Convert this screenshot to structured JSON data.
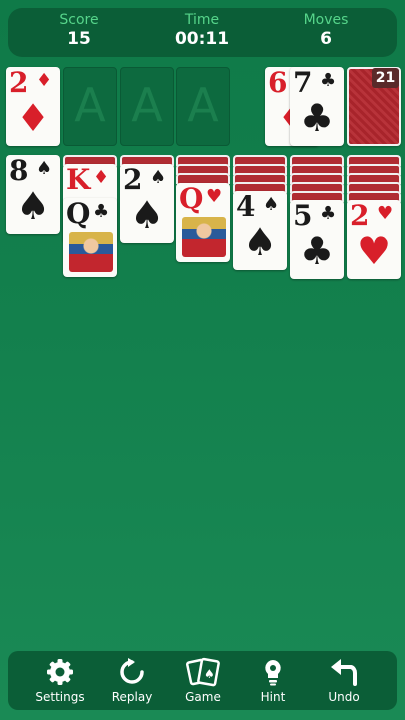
{
  "header": {
    "score_label": "Score",
    "score_value": "15",
    "time_label": "Time",
    "time_value": "00:11",
    "moves_label": "Moves",
    "moves_value": "6"
  },
  "foundations": [
    {
      "rank": "2",
      "suit": "♦",
      "color": "red"
    },
    {
      "placeholder": "A"
    },
    {
      "placeholder": "A"
    },
    {
      "placeholder": "A"
    }
  ],
  "waste": [
    {
      "rank": "6",
      "suit": "♦",
      "color": "red"
    },
    {
      "rank": "7",
      "suit": "♣",
      "color": "black"
    }
  ],
  "stock": {
    "count": "21"
  },
  "tableau": [
    {
      "top": {
        "rank": "8",
        "suit": "♠",
        "color": "black"
      }
    },
    {
      "peek": {
        "rank": "K",
        "suit": "♦",
        "color": "red"
      },
      "top": {
        "rank": "Q",
        "suit": "♣",
        "color": "black"
      }
    },
    {
      "top": {
        "rank": "2",
        "suit": "♠",
        "color": "black"
      }
    },
    {
      "top": {
        "rank": "Q",
        "suit": "♥",
        "color": "red"
      }
    },
    {
      "top": {
        "rank": "4",
        "suit": "♠",
        "color": "black"
      }
    },
    {
      "top": {
        "rank": "5",
        "suit": "♣",
        "color": "black"
      }
    },
    {
      "top": {
        "rank": "2",
        "suit": "♥",
        "color": "red"
      }
    }
  ],
  "toolbar": [
    {
      "label": "Settings",
      "icon": "gear-icon"
    },
    {
      "label": "Replay",
      "icon": "replay-icon"
    },
    {
      "label": "Game",
      "icon": "cards-icon"
    },
    {
      "label": "Hint",
      "icon": "lightbulb-icon"
    },
    {
      "label": "Undo",
      "icon": "undo-icon"
    }
  ]
}
